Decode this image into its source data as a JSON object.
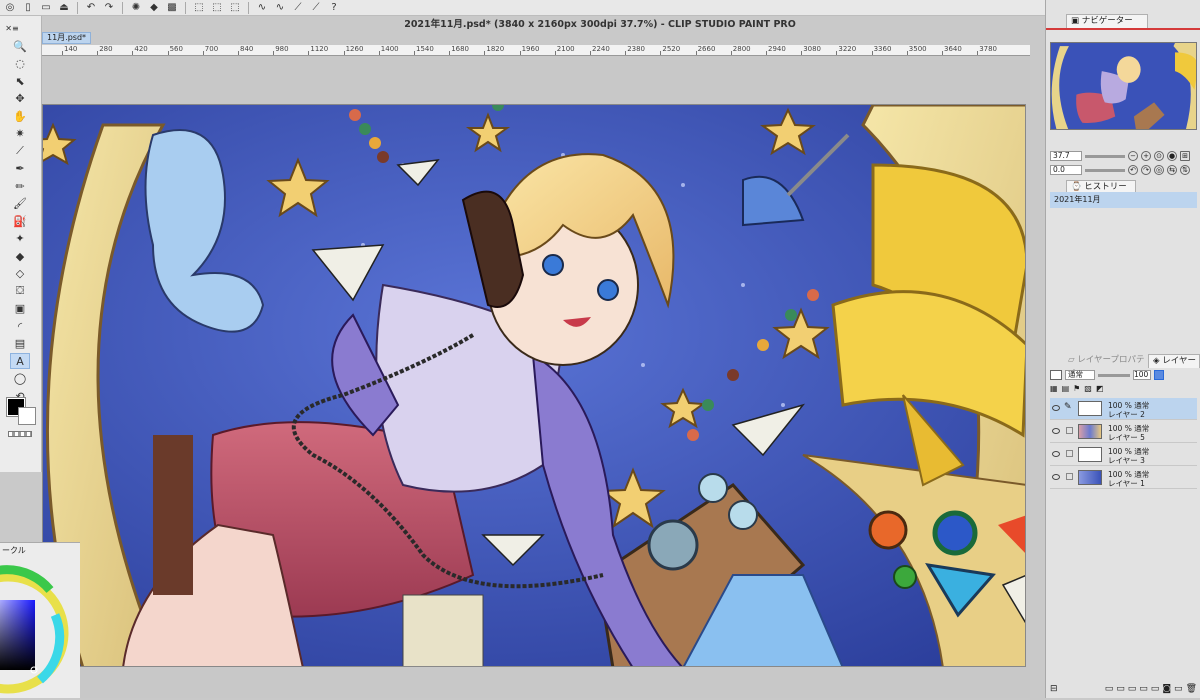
{
  "window": {
    "title": "2021年11月.psd* (3840 x 2160px 300dpi 37.7%)  - CLIP STUDIO PAINT PRO",
    "doc_tab": "11月.psd*"
  },
  "ruler": {
    "labels": [
      "140",
      "280",
      "420",
      "560",
      "700",
      "840",
      "980",
      "1120",
      "1260",
      "1400",
      "1540",
      "1680",
      "1820",
      "1960",
      "2100",
      "2240",
      "2380",
      "2520",
      "2660",
      "2800",
      "2940",
      "3080",
      "3220",
      "3360",
      "3500",
      "3640",
      "3780"
    ]
  },
  "navigator": {
    "tab_label": "ナビゲーター",
    "zoom_value": "37.7",
    "rotate_value": "0.0"
  },
  "history": {
    "tab_label": "ヒストリー",
    "items": [
      "2021年11月"
    ]
  },
  "layer_panel": {
    "tab_property": "レイヤープロパティ",
    "tab_layer": "レイヤー",
    "blend_mode": "通常",
    "opacity": "100",
    "layers": [
      {
        "opacity_mode": "100 % 通常",
        "name": "レイヤー 2",
        "selected": true
      },
      {
        "opacity_mode": "100 % 通常",
        "name": "レイヤー 5",
        "selected": false
      },
      {
        "opacity_mode": "100 % 通常",
        "name": "レイヤー 3",
        "selected": false
      },
      {
        "opacity_mode": "100 % 通常",
        "name": "レイヤー 1",
        "selected": false
      }
    ]
  },
  "color_panel": {
    "tab_label": "ークル"
  },
  "tools": [
    "zoom-icon",
    "lasso-select-icon",
    "object-select-icon",
    "move-icon",
    "hand-icon",
    "auto-select-icon",
    "eyedropper-icon",
    "pen-icon",
    "pencil-icon",
    "brush-icon",
    "airbrush-icon",
    "decoration-icon",
    "eraser-icon",
    "blend-icon",
    "fill-icon",
    "gradient-icon",
    "figure-icon",
    "frame-icon",
    "text-icon",
    "balloon-icon",
    "correction-icon"
  ],
  "colors": {
    "main": "#000000",
    "sub": "#ffffff",
    "accent": "#bcd4ee",
    "canvas_bg": "#3a52b8"
  }
}
